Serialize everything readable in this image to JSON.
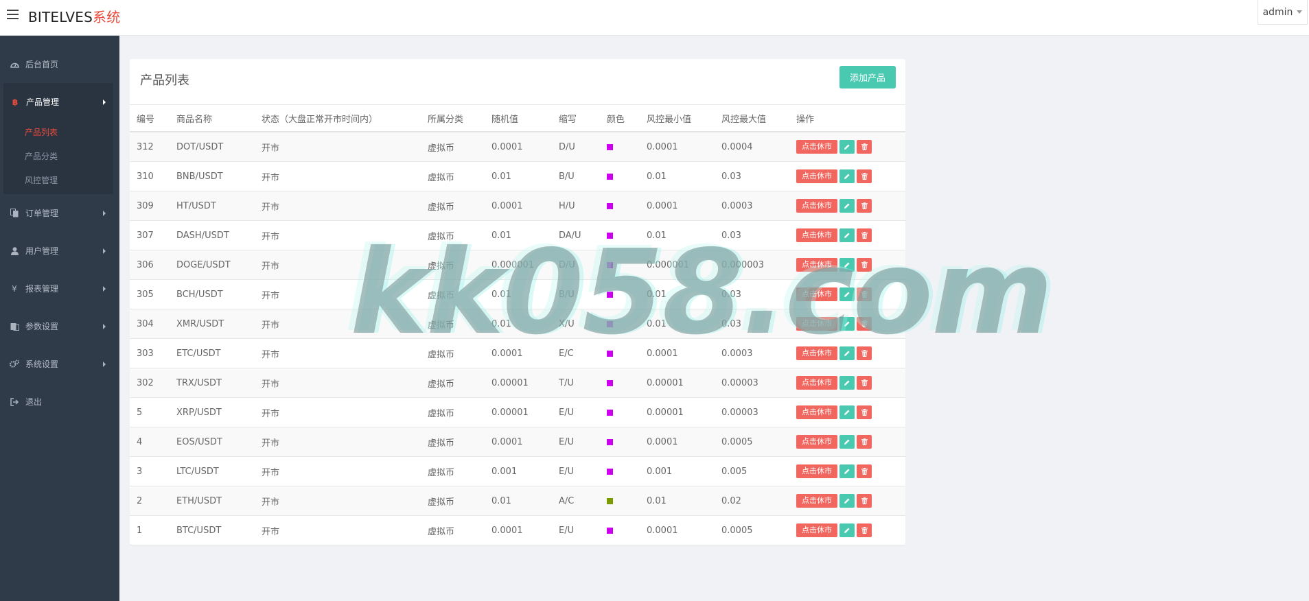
{
  "app": {
    "brand_main": "BITELVES",
    "brand_suffix": "系统",
    "user": "admin"
  },
  "sidebar": {
    "items": [
      {
        "label": "后台首页",
        "icon": "dashboard-icon"
      },
      {
        "label": "产品管理",
        "icon": "bitcoin-icon",
        "expanded": true,
        "children": [
          {
            "label": "产品列表",
            "active": true
          },
          {
            "label": "产品分类",
            "active": false
          },
          {
            "label": "风控管理",
            "active": false
          }
        ]
      },
      {
        "label": "订单管理",
        "icon": "copy-icon"
      },
      {
        "label": "用户管理",
        "icon": "user-icon"
      },
      {
        "label": "报表管理",
        "icon": "yen-icon"
      },
      {
        "label": "参数设置",
        "icon": "book-icon"
      },
      {
        "label": "系统设置",
        "icon": "gears-icon"
      },
      {
        "label": "退出",
        "icon": "sign-out-icon"
      }
    ]
  },
  "panel": {
    "title": "产品列表",
    "add_button": "添加产品"
  },
  "table": {
    "headers": [
      "编号",
      "商品名称",
      "状态（大盘正常开市时间内）",
      "所属分类",
      "随机值",
      "缩写",
      "颜色",
      "风控最小值",
      "风控最大值",
      "操作"
    ],
    "action_label": "点击休市",
    "rows": [
      {
        "id": "312",
        "name": "DOT/USDT",
        "status": "开市",
        "category": "虚拟币",
        "random": "0.0001",
        "abbr": "D/U",
        "color": "#cc00ee",
        "min": "0.0001",
        "max": "0.0004"
      },
      {
        "id": "310",
        "name": "BNB/USDT",
        "status": "开市",
        "category": "虚拟币",
        "random": "0.01",
        "abbr": "B/U",
        "color": "#cc00ee",
        "min": "0.01",
        "max": "0.03"
      },
      {
        "id": "309",
        "name": "HT/USDT",
        "status": "开市",
        "category": "虚拟币",
        "random": "0.0001",
        "abbr": "H/U",
        "color": "#cc00ee",
        "min": "0.0001",
        "max": "0.0003"
      },
      {
        "id": "307",
        "name": "DASH/USDT",
        "status": "开市",
        "category": "虚拟币",
        "random": "0.01",
        "abbr": "DA/U",
        "color": "#cc00ee",
        "min": "0.01",
        "max": "0.03"
      },
      {
        "id": "306",
        "name": "DOGE/USDT",
        "status": "开市",
        "category": "虚拟币",
        "random": "0.000001",
        "abbr": "D/U",
        "color": "#cc00ee",
        "min": "0.000001",
        "max": "0.000003"
      },
      {
        "id": "305",
        "name": "BCH/USDT",
        "status": "开市",
        "category": "虚拟币",
        "random": "0.01",
        "abbr": "B/U",
        "color": "#cc00ee",
        "min": "0.01",
        "max": "0.03"
      },
      {
        "id": "304",
        "name": "XMR/USDT",
        "status": "开市",
        "category": "虚拟币",
        "random": "0.01",
        "abbr": "X/U",
        "color": "#cc00ee",
        "min": "0.01",
        "max": "0.03"
      },
      {
        "id": "303",
        "name": "ETC/USDT",
        "status": "开市",
        "category": "虚拟币",
        "random": "0.0001",
        "abbr": "E/C",
        "color": "#cc00ee",
        "min": "0.0001",
        "max": "0.0003"
      },
      {
        "id": "302",
        "name": "TRX/USDT",
        "status": "开市",
        "category": "虚拟币",
        "random": "0.00001",
        "abbr": "T/U",
        "color": "#cc00ee",
        "min": "0.00001",
        "max": "0.00003"
      },
      {
        "id": "5",
        "name": "XRP/USDT",
        "status": "开市",
        "category": "虚拟币",
        "random": "0.00001",
        "abbr": "E/U",
        "color": "#cc00ee",
        "min": "0.00001",
        "max": "0.00003"
      },
      {
        "id": "4",
        "name": "EOS/USDT",
        "status": "开市",
        "category": "虚拟币",
        "random": "0.0001",
        "abbr": "E/U",
        "color": "#cc00ee",
        "min": "0.0001",
        "max": "0.0005"
      },
      {
        "id": "3",
        "name": "LTC/USDT",
        "status": "开市",
        "category": "虚拟币",
        "random": "0.001",
        "abbr": "E/U",
        "color": "#cc00ee",
        "min": "0.001",
        "max": "0.005"
      },
      {
        "id": "2",
        "name": "ETH/USDT",
        "status": "开市",
        "category": "虚拟币",
        "random": "0.01",
        "abbr": "A/C",
        "color": "#7a9a00",
        "min": "0.01",
        "max": "0.02"
      },
      {
        "id": "1",
        "name": "BTC/USDT",
        "status": "开市",
        "category": "虚拟币",
        "random": "0.0001",
        "abbr": "E/U",
        "color": "#cc00ee",
        "min": "0.0001",
        "max": "0.0005"
      }
    ]
  },
  "watermark": "kk058.com"
}
